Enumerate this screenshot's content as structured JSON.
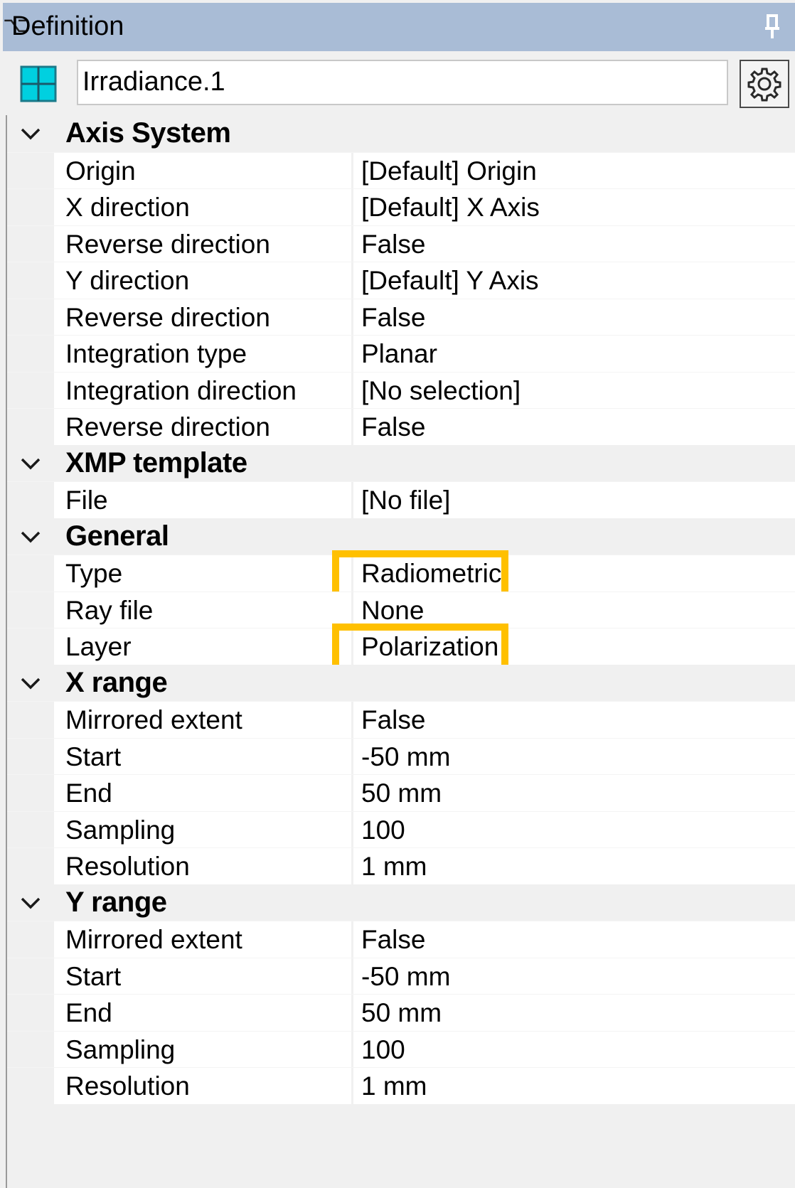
{
  "panel": {
    "title": "Definition"
  },
  "toolbar": {
    "name_value": "Irradiance.1"
  },
  "colors": {
    "title_bar": "#a9bcd6",
    "highlight": "#ffc000",
    "icon_cyan": "#00d0e0"
  },
  "icons": {
    "pin": "pin-icon",
    "object": "sensor-grid-icon",
    "settings": "gear-icon",
    "expand": "chevron-down-icon"
  },
  "groups": [
    {
      "label": "Axis System",
      "rows": [
        {
          "name": "Origin",
          "value": "[Default] Origin"
        },
        {
          "name": "X direction",
          "value": "[Default] X Axis"
        },
        {
          "name": "Reverse direction",
          "value": "False"
        },
        {
          "name": "Y direction",
          "value": "[Default] Y Axis"
        },
        {
          "name": "Reverse direction",
          "value": "False"
        },
        {
          "name": "Integration type",
          "value": "Planar"
        },
        {
          "name": "Integration direction",
          "value": "[No selection]"
        },
        {
          "name": "Reverse direction",
          "value": "False"
        }
      ]
    },
    {
      "label": "XMP template",
      "rows": [
        {
          "name": "File",
          "value": "[No file]"
        }
      ]
    },
    {
      "label": "General",
      "rows": [
        {
          "name": "Type",
          "value": "Radiometric",
          "highlighted": true
        },
        {
          "name": "Ray file",
          "value": "None"
        },
        {
          "name": "Layer",
          "value": "Polarization",
          "highlighted": true
        }
      ]
    },
    {
      "label": "X range",
      "rows": [
        {
          "name": "Mirrored extent",
          "value": "False"
        },
        {
          "name": "Start",
          "value": "-50 mm"
        },
        {
          "name": "End",
          "value": "50 mm"
        },
        {
          "name": "Sampling",
          "value": "100"
        },
        {
          "name": "Resolution",
          "value": "1 mm"
        }
      ]
    },
    {
      "label": "Y range",
      "rows": [
        {
          "name": "Mirrored extent",
          "value": "False"
        },
        {
          "name": "Start",
          "value": "-50 mm"
        },
        {
          "name": "End",
          "value": "50 mm"
        },
        {
          "name": "Sampling",
          "value": "100"
        },
        {
          "name": "Resolution",
          "value": "1 mm"
        }
      ]
    }
  ]
}
